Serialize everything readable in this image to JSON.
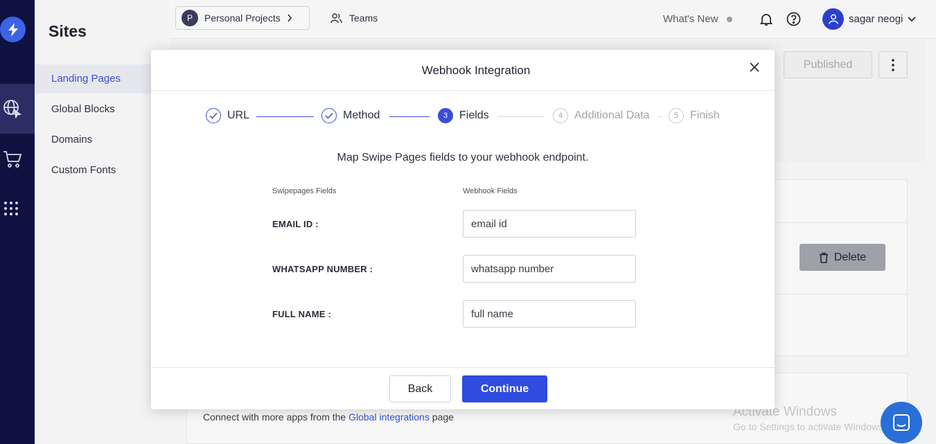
{
  "sidebar": {
    "title": "Sites",
    "items": [
      {
        "label": "Landing Pages",
        "active": true
      },
      {
        "label": "Global Blocks"
      },
      {
        "label": "Domains"
      },
      {
        "label": "Custom Fonts"
      }
    ]
  },
  "topbar": {
    "project_initial": "P",
    "project_label": "Personal Projects",
    "teams_label": "Teams",
    "whats_new": "What's New",
    "user_name": "sagar neogi"
  },
  "background": {
    "published_label": "Published",
    "delete_label": "Delete",
    "connect_prefix": "Connect with more apps from the ",
    "connect_link": "Global integrations",
    "connect_suffix": " page",
    "activate_title": "Activate Windows",
    "activate_sub": "Go to Settings to activate Windows."
  },
  "modal": {
    "title": "Webhook Integration",
    "steps": [
      {
        "label": "URL",
        "state": "done"
      },
      {
        "label": "Method",
        "state": "done"
      },
      {
        "label": "Fields",
        "number": "3",
        "state": "current"
      },
      {
        "label": "Additional Data",
        "number": "4",
        "state": "pending"
      },
      {
        "label": "Finish",
        "number": "5",
        "state": "pending"
      }
    ],
    "intro": "Map Swipe Pages fields to your webhook endpoint.",
    "col_left": "Swipepages Fields",
    "col_right": "Webhook Fields",
    "fields": [
      {
        "label": "EMAIL ID :",
        "value": "email id"
      },
      {
        "label": "WHATSAPP NUMBER :",
        "value": "whatsapp number"
      },
      {
        "label": "FULL NAME :",
        "value": "full name"
      }
    ],
    "back_label": "Back",
    "continue_label": "Continue"
  },
  "colors": {
    "accent": "#2f4be0",
    "rail": "#0f1240"
  }
}
